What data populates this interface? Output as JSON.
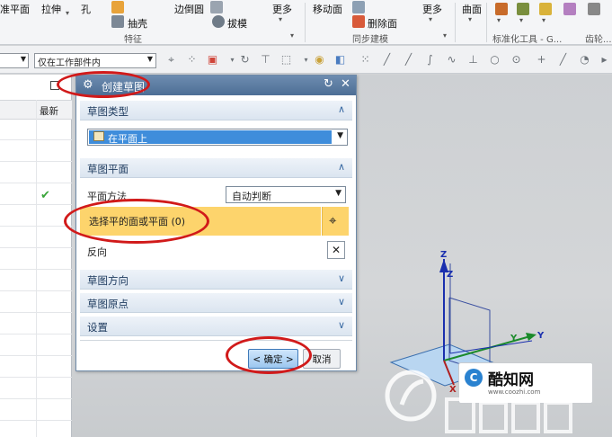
{
  "ribbon": {
    "items": {
      "datum_plane": "准平面",
      "extrude": "拉伸",
      "hole": "孔",
      "shell": "抽壳",
      "edge_blend": "边倒圆",
      "draft": "拔模",
      "more1": "更多",
      "move_face": "移动面",
      "delete_face": "删除面",
      "more2": "更多",
      "surface": "曲面"
    },
    "groups": {
      "feature": "特征",
      "sync_modeling": "同步建模",
      "standard_tools": "标准化工具 - G...",
      "gear": "齿轮..."
    }
  },
  "toolbar": {
    "filter_value": "",
    "scope_value": "仅在工作部件内"
  },
  "navigator": {
    "col_latest": "最新",
    "check": "✔"
  },
  "dialog": {
    "title": "创建草图",
    "sections": {
      "sketch_type": "草图类型",
      "sketch_plane": "草图平面",
      "sketch_orientation": "草图方向",
      "sketch_origin": "草图原点",
      "settings": "设置"
    },
    "type_value": "在平面上",
    "plane_method_label": "平面方法",
    "plane_method_value": "自动判断",
    "select_label": "选择平的面或平面 (0)",
    "reverse_label": "反向",
    "ok_label": "< 确定 >",
    "cancel_label": "取消"
  },
  "axes": {
    "z1": "Z",
    "z2": "Z",
    "y1": "Y",
    "y2": "Y",
    "x": "X"
  },
  "watermark": {
    "brand": "酷知网",
    "url": "www.coozhi.com"
  },
  "colors": {
    "highlight": "#fdd46c",
    "selection_blue": "#3f8ddb",
    "title_bar": "#5a7aa0",
    "annotation_red": "#d11a1a"
  }
}
